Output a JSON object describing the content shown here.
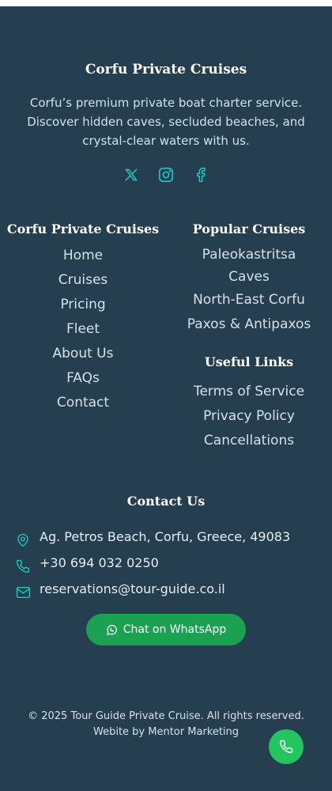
{
  "brand": {
    "title": "Corfu Private Cruises",
    "description": "Corfu’s premium private boat charter service. Discover hidden caves, secluded beaches, and crystal-clear waters with us."
  },
  "social": [
    {
      "icon": "x-twitter-icon"
    },
    {
      "icon": "instagram-icon"
    },
    {
      "icon": "facebook-icon"
    }
  ],
  "nav_column": {
    "heading": "Corfu Private Cruises",
    "links": [
      "Home",
      "Cruises",
      "Pricing",
      "Fleet",
      "About Us",
      "FAQs",
      "Contact"
    ]
  },
  "popular_cruises": {
    "heading": "Popular Cruises",
    "links": [
      "Paleokastritsa Caves",
      "North-East Corfu",
      "Paxos & Antipaxos"
    ]
  },
  "useful_links": {
    "heading": "Useful Links",
    "links": [
      "Terms of Service",
      "Privacy Policy",
      "Cancellations"
    ]
  },
  "contact": {
    "heading": "Contact Us",
    "address": "Ag. Petros Beach, Corfu, Greece, 49083",
    "phone": "+30 694 032 0250",
    "email": "reservations@tour-guide.co.il"
  },
  "whatsapp": {
    "label": "Chat on WhatsApp"
  },
  "footer": {
    "copyright": "© 2025 Tour Guide Private Cruise. All rights reserved.",
    "credit": "Webite by Mentor Marketing"
  },
  "colors": {
    "background": "#263f50",
    "accent": "#1fc7c1",
    "whatsapp": "#1aa152",
    "call": "#22c55e"
  }
}
